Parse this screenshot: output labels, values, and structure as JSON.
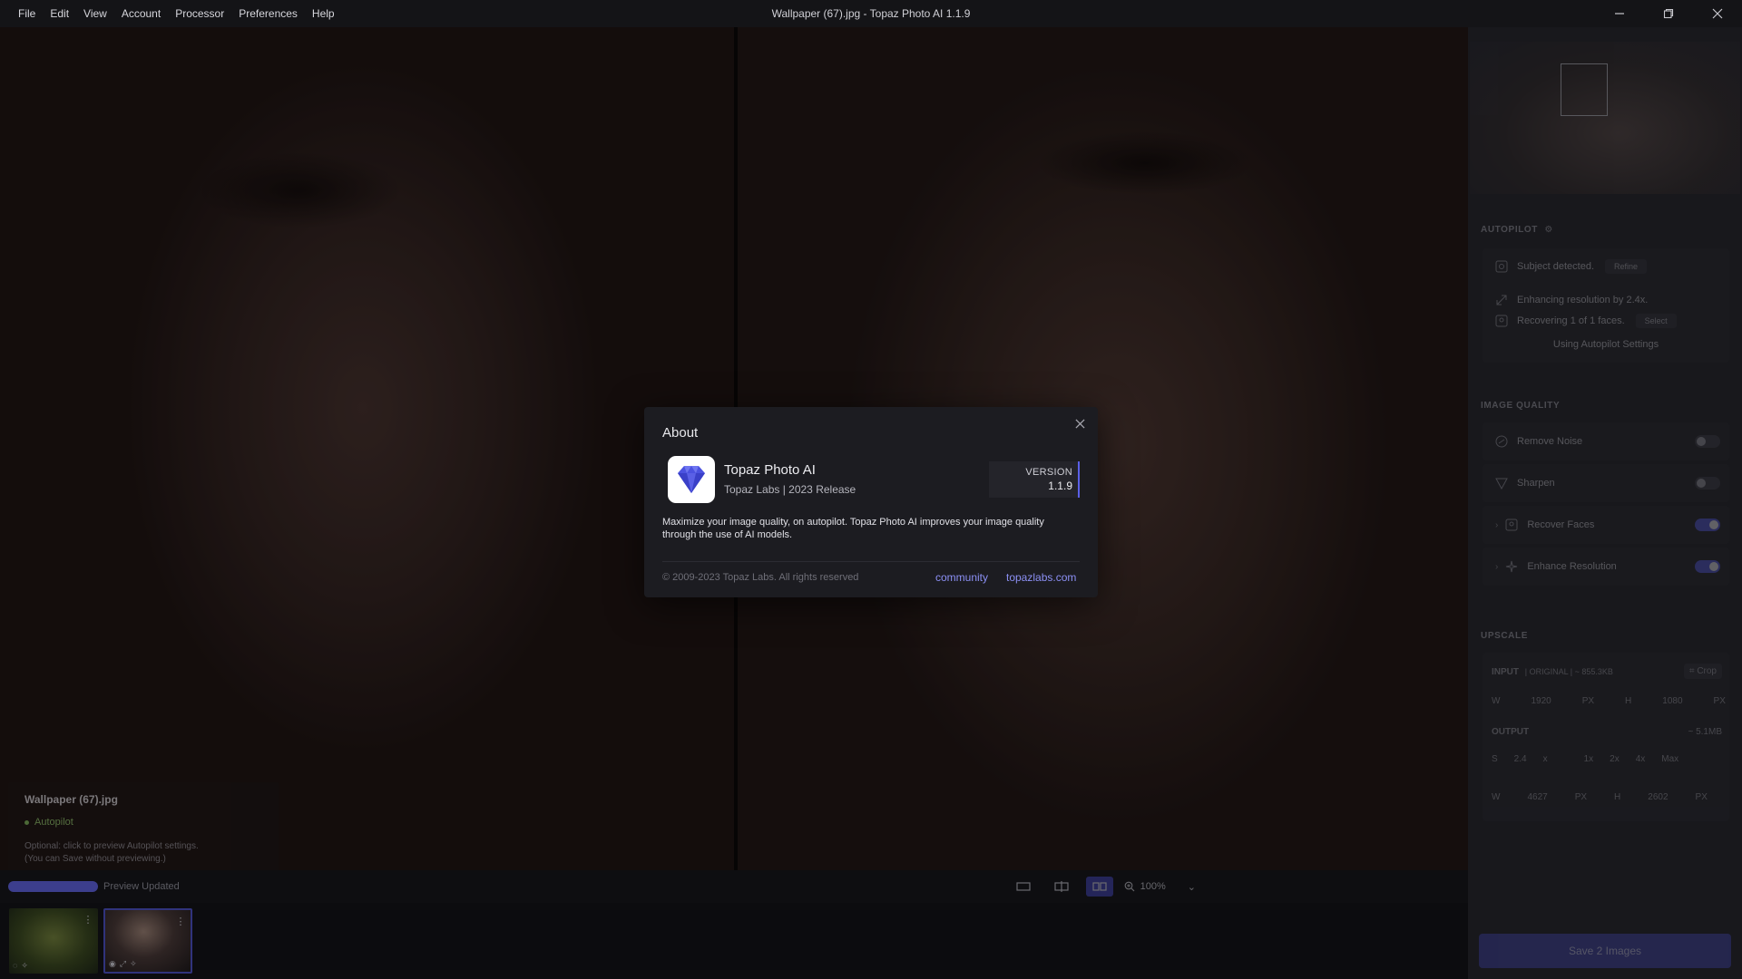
{
  "window": {
    "title": "Wallpaper (67).jpg - Topaz Photo AI 1.1.9",
    "menu": [
      "File",
      "Edit",
      "View",
      "Account",
      "Processor",
      "Preferences",
      "Help"
    ]
  },
  "canvas": {
    "info_card": {
      "filename": "Wallpaper (67).jpg",
      "autopilot": "Autopilot",
      "note_line1": "Optional: click to preview Autopilot settings.",
      "note_line2": "(You can Save without previewing.)"
    },
    "status": {
      "text": "Preview Updated",
      "progress": 1.0
    },
    "zoom_level": "100%"
  },
  "sidebar": {
    "autopilot": {
      "label": "AUTOPILOT",
      "subject": "Subject detected.",
      "refine": "Refine",
      "enhancing": "Enhancing resolution by 2.4x.",
      "recovering": "Recovering 1 of 1 faces.",
      "select": "Select",
      "using": "Using Autopilot Settings"
    },
    "image_quality": {
      "label": "IMAGE QUALITY",
      "items": [
        {
          "label": "Remove Noise",
          "on": false
        },
        {
          "label": "Sharpen",
          "on": false
        },
        {
          "label": "Recover Faces",
          "on": true
        },
        {
          "label": "Enhance Resolution",
          "on": true
        }
      ]
    },
    "upscale": {
      "label": "UPSCALE",
      "input_label": "INPUT",
      "input_meta": "| ORIGINAL | ~ 855.3KB",
      "crop": "Crop",
      "w_label": "W",
      "in_w": "1920",
      "h_label": "H",
      "in_h": "1080",
      "px": "PX",
      "output_label": "OUTPUT",
      "output_meta": "~ 5.1MB",
      "scale_label": "S",
      "scale": "2.4",
      "scale_unit": "x",
      "presets": [
        "1x",
        "2x",
        "4x",
        "Max"
      ],
      "out_w": "4627",
      "out_h": "2602"
    },
    "save": "Save 2 Images"
  },
  "modal": {
    "title": "About",
    "app_name": "Topaz Photo AI",
    "app_sub": "Topaz Labs | 2023 Release",
    "version_label": "VERSION",
    "version": "1.1.9",
    "description": "Maximize your image quality, on autopilot. Topaz Photo AI improves your image quality through the use of AI models.",
    "copyright": "© 2009-2023 Topaz Labs. All rights reserved",
    "links": {
      "community": "community",
      "site": "topazlabs.com"
    }
  },
  "colors": {
    "accent": "#5b60e8",
    "link": "#8c90f5",
    "panel": "#1c1c21"
  }
}
